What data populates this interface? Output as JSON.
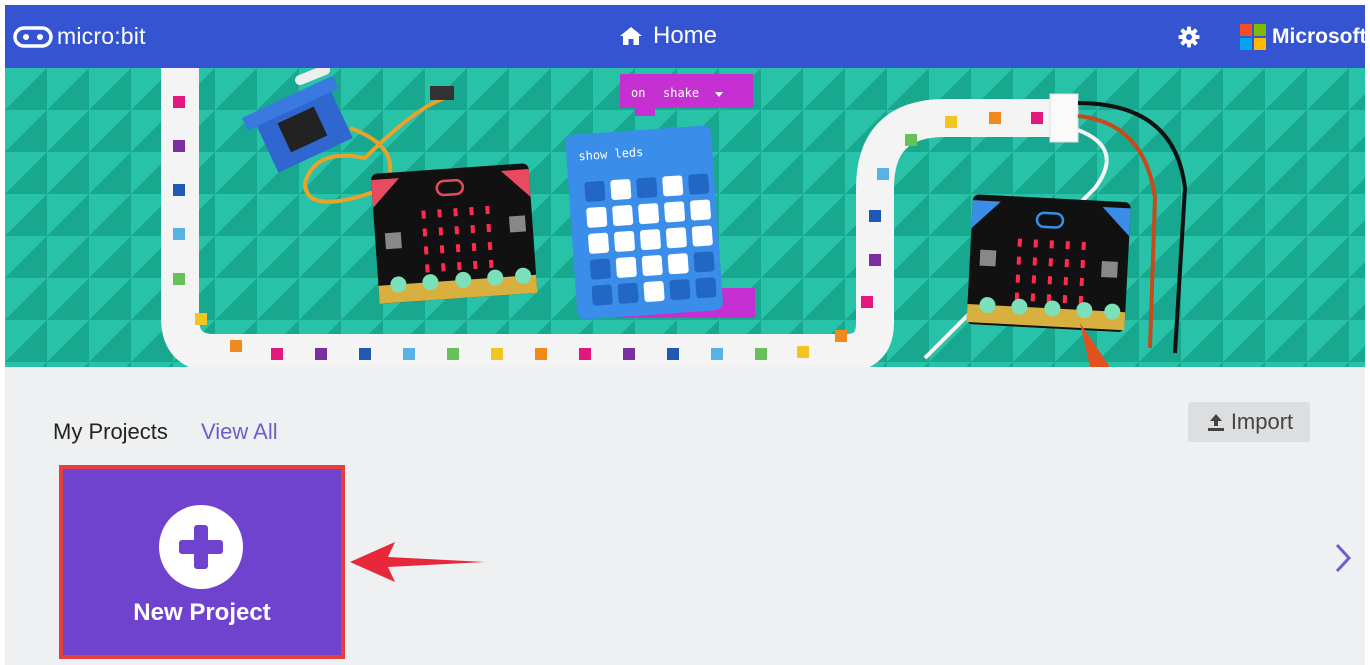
{
  "header": {
    "brand": "micro:bit",
    "home_label": "Home",
    "microsoft_label": "Microsoft"
  },
  "hero": {
    "block_on": "on",
    "block_shake": "shake",
    "block_show_leds": "show leds"
  },
  "projects": {
    "section_title": "My Projects",
    "view_all": "View All",
    "import_label": "Import",
    "new_project_label": "New Project"
  },
  "colors": {
    "header_bg": "#3454d1",
    "hero_bg": "#1fb59d",
    "new_project_bg": "#7043cf",
    "highlight_red": "#e53e3e",
    "link_purple": "#6a5ed0"
  },
  "icons": [
    "microbit-logo-icon",
    "home-icon",
    "gear-icon",
    "microsoft-logo-icon",
    "upload-icon",
    "plus-icon",
    "chevron-right-icon",
    "red-arrow-annotation"
  ]
}
